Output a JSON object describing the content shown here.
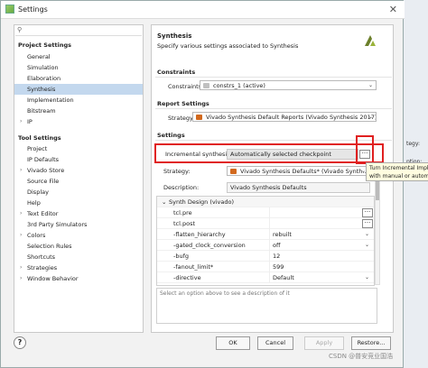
{
  "window": {
    "title": "Settings",
    "close_glyph": "✕"
  },
  "search": {
    "glyph": "⚲",
    "placeholder": ""
  },
  "left_panel": {
    "project_settings_header": "Project Settings",
    "project_items": [
      {
        "label": "General",
        "expandable": false
      },
      {
        "label": "Simulation",
        "expandable": false
      },
      {
        "label": "Elaboration",
        "expandable": false
      },
      {
        "label": "Synthesis",
        "expandable": false,
        "selected": true
      },
      {
        "label": "Implementation",
        "expandable": false
      },
      {
        "label": "Bitstream",
        "expandable": false
      },
      {
        "label": "IP",
        "expandable": true
      }
    ],
    "tool_settings_header": "Tool Settings",
    "tool_items": [
      {
        "label": "Project",
        "expandable": false
      },
      {
        "label": "IP Defaults",
        "expandable": false
      },
      {
        "label": "Vivado Store",
        "expandable": true
      },
      {
        "label": "Source File",
        "expandable": false
      },
      {
        "label": "Display",
        "expandable": false
      },
      {
        "label": "Help",
        "expandable": false
      },
      {
        "label": "Text Editor",
        "expandable": true
      },
      {
        "label": "3rd Party Simulators",
        "expandable": false
      },
      {
        "label": "Colors",
        "expandable": true
      },
      {
        "label": "Selection Rules",
        "expandable": false
      },
      {
        "label": "Shortcuts",
        "expandable": false
      },
      {
        "label": "Strategies",
        "expandable": true
      },
      {
        "label": "Window Behavior",
        "expandable": true
      }
    ]
  },
  "main": {
    "title": "Synthesis",
    "subtitle": "Specify various settings associated to Synthesis",
    "constraints_header": "Constraints",
    "constraints_label": "Constraints",
    "constraints_value": "constrs_1 (active)",
    "report_settings_header": "Report Settings",
    "report_strategy_label": "Strategy:",
    "report_strategy_value": "Vivado Synthesis Default Reports (Vivado Synthesis 2017)",
    "settings_header": "Settings",
    "incremental_label": "Incremental synthesis:",
    "incremental_value": "Automatically selected checkpoint",
    "dots_label": "···",
    "strategy_label": "Strategy:",
    "strategy_value": "Vivado Synthesis Defaults* (Vivado Synth...",
    "description_label": "Description:",
    "description_value": "Vivado Synthesis Defaults",
    "group_label": "Synth Design (vivado)",
    "options": [
      {
        "key": "tcl.pre",
        "value": "",
        "kind": "dots"
      },
      {
        "key": "tcl.post",
        "value": "",
        "kind": "dots"
      },
      {
        "key": "-flatten_hierarchy",
        "value": "rebuilt",
        "kind": "dropdown"
      },
      {
        "key": "-gated_clock_conversion",
        "value": "off",
        "kind": "dropdown"
      },
      {
        "key": "-bufg",
        "value": "12",
        "kind": "text"
      },
      {
        "key": "-fanout_limit*",
        "value": "599",
        "kind": "text"
      },
      {
        "key": "-directive",
        "value": "Default",
        "kind": "dropdown"
      }
    ],
    "desc_hint": "Select an option above to see a description of it"
  },
  "tooltip": {
    "line1": "Turn Incremental Implem",
    "line2": "with manual or automat"
  },
  "outside_text": {
    "tegy": "tegy:",
    "ption": "ption:"
  },
  "buttons": {
    "ok": "OK",
    "cancel": "Cancel",
    "apply": "Apply",
    "restore": "Restore..."
  },
  "help_glyph": "?",
  "watermark": "CSDN @普安竞业国浩",
  "colors": {
    "highlight_red": "#e02020",
    "selection": "#c3d8ee"
  }
}
